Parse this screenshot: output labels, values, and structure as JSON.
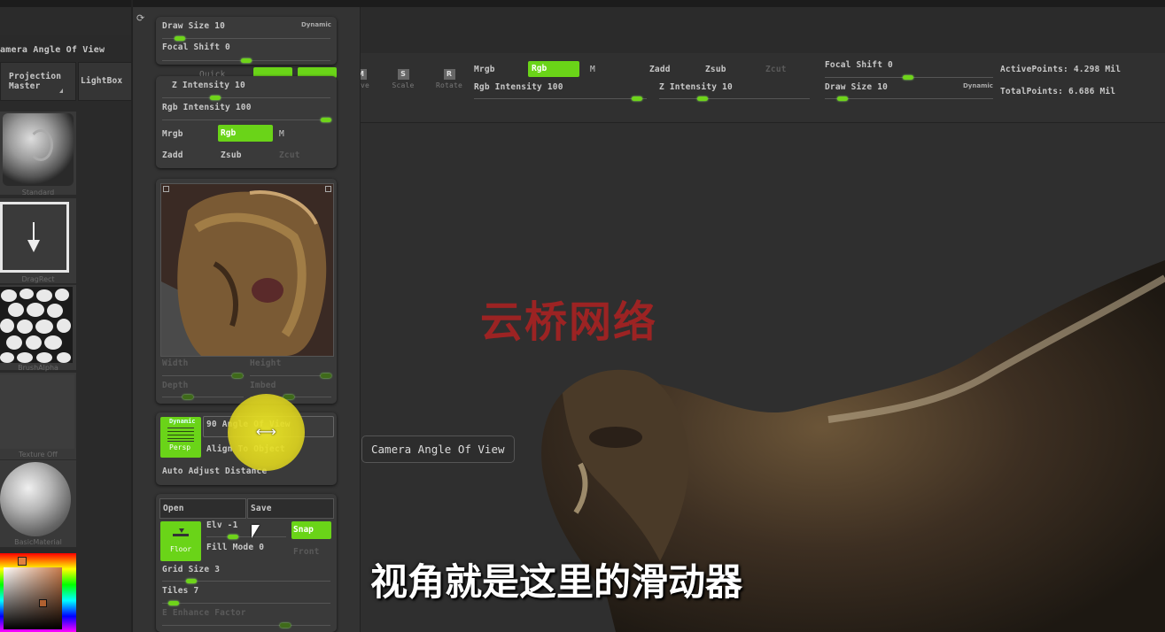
{
  "colors": {
    "accent": "#6ad418",
    "bg": "#2b2b2b",
    "panel": "#3a3a3a",
    "watermark": "#b02222"
  },
  "left_panel": {
    "title": "amera Angle Of View",
    "projection_master": "Projection\nMaster",
    "lightbox": "LightBox",
    "tiles": [
      {
        "label": "Standard",
        "icon": "standard-brush-icon"
      },
      {
        "label": "DragRect",
        "icon": "drag-rect-stroke-icon"
      },
      {
        "label": "BrushAlpha",
        "icon": "alpha-texture-icon"
      },
      {
        "label": "Texture Off",
        "icon": "texture-off-icon"
      },
      {
        "label": "BasicMaterial",
        "icon": "material-sphere-icon"
      }
    ]
  },
  "top_toolbar": {
    "move": "Move",
    "scale": "Scale",
    "rotate": "Rotate",
    "mrgb": "Mrgb",
    "rgb": "Rgb",
    "m": "M",
    "zadd": "Zadd",
    "zsub": "Zsub",
    "zcut": "Zcut",
    "rgb_intensity": "Rgb Intensity 100",
    "z_intensity": "Z Intensity 10",
    "focal_shift": "Focal Shift 0",
    "draw_size": "Draw Size 10",
    "dynamic": "Dynamic",
    "active_points": "ActivePoints: 4.298 Mil",
    "total_points": "TotalPoints: 6.686 Mil",
    "quick": "Quick",
    "rgb_intensity_value": 100,
    "z_intensity_value": 10,
    "focal_shift_value": 0,
    "draw_size_value": 10
  },
  "popup": {
    "draw_size": "Draw Size 10",
    "dynamic": "Dynamic",
    "focal_shift": "Focal Shift 0",
    "z_intensity": "Z Intensity 10",
    "rgb_intensity": "Rgb Intensity 100",
    "mrgb": "Mrgb",
    "rgb": "Rgb",
    "m": "M",
    "zadd": "Zadd",
    "zsub": "Zsub",
    "zcut": "Zcut",
    "width": "Width",
    "height": "Height",
    "depth": "Depth",
    "imbed": "Imbed",
    "persp_dynamic": "Dynamic",
    "persp": "Persp",
    "angle_of_view": "90 Angle Of View",
    "align_to_object": "Align To Object",
    "auto_adjust_distance": "Auto Adjust Distance",
    "open": "Open",
    "save": "Save",
    "elv": "Elv -1",
    "snap": "Snap",
    "floor": "Floor",
    "fill_mode": "Fill Mode 0",
    "front": "Front",
    "grid_size": "Grid Size 3",
    "tiles": "Tiles 7",
    "e_enhance": "E Enhance Factor",
    "angle_of_view_value": 90,
    "elv_value": -1
  },
  "tooltip": "Camera Angle Of View",
  "watermark": "云桥网络",
  "subtitle": "视角就是这里的滑动器"
}
